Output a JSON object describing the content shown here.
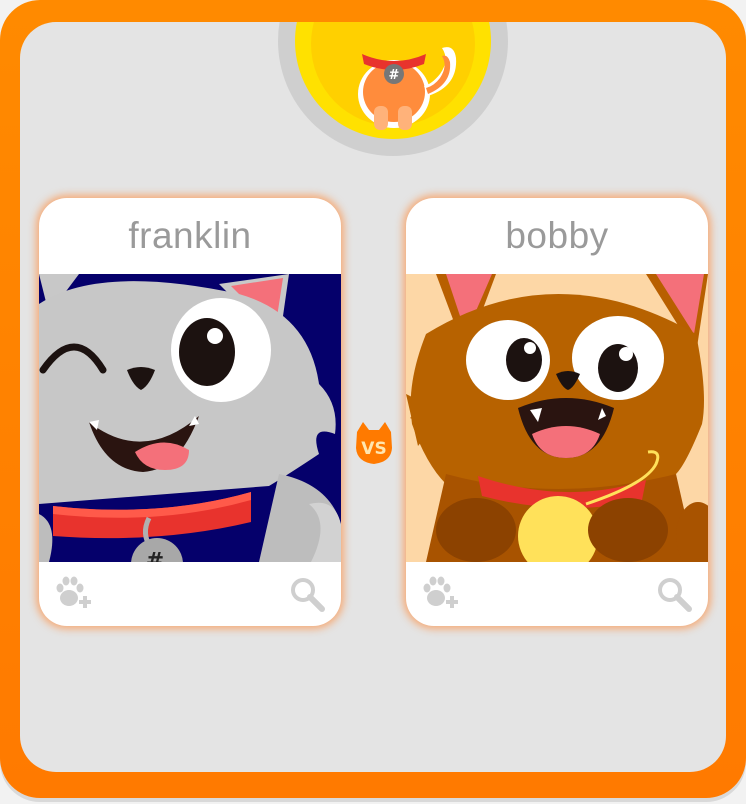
{
  "app": {
    "badge_icon": "cat-hashtag-badge-icon",
    "vs_text": "VS",
    "colors": {
      "frame": "#ff7a00",
      "panel": "#e4e4e4",
      "card_glow": "#ff8c3c",
      "name_text": "#9a9a9a"
    }
  },
  "cards": [
    {
      "name": "franklin",
      "image": "gray-winking-cat",
      "add_icon": "paw-plus-icon",
      "zoom_icon": "search-icon"
    },
    {
      "name": "bobby",
      "image": "brown-cat-with-yarn",
      "add_icon": "paw-plus-icon",
      "zoom_icon": "search-icon"
    }
  ]
}
